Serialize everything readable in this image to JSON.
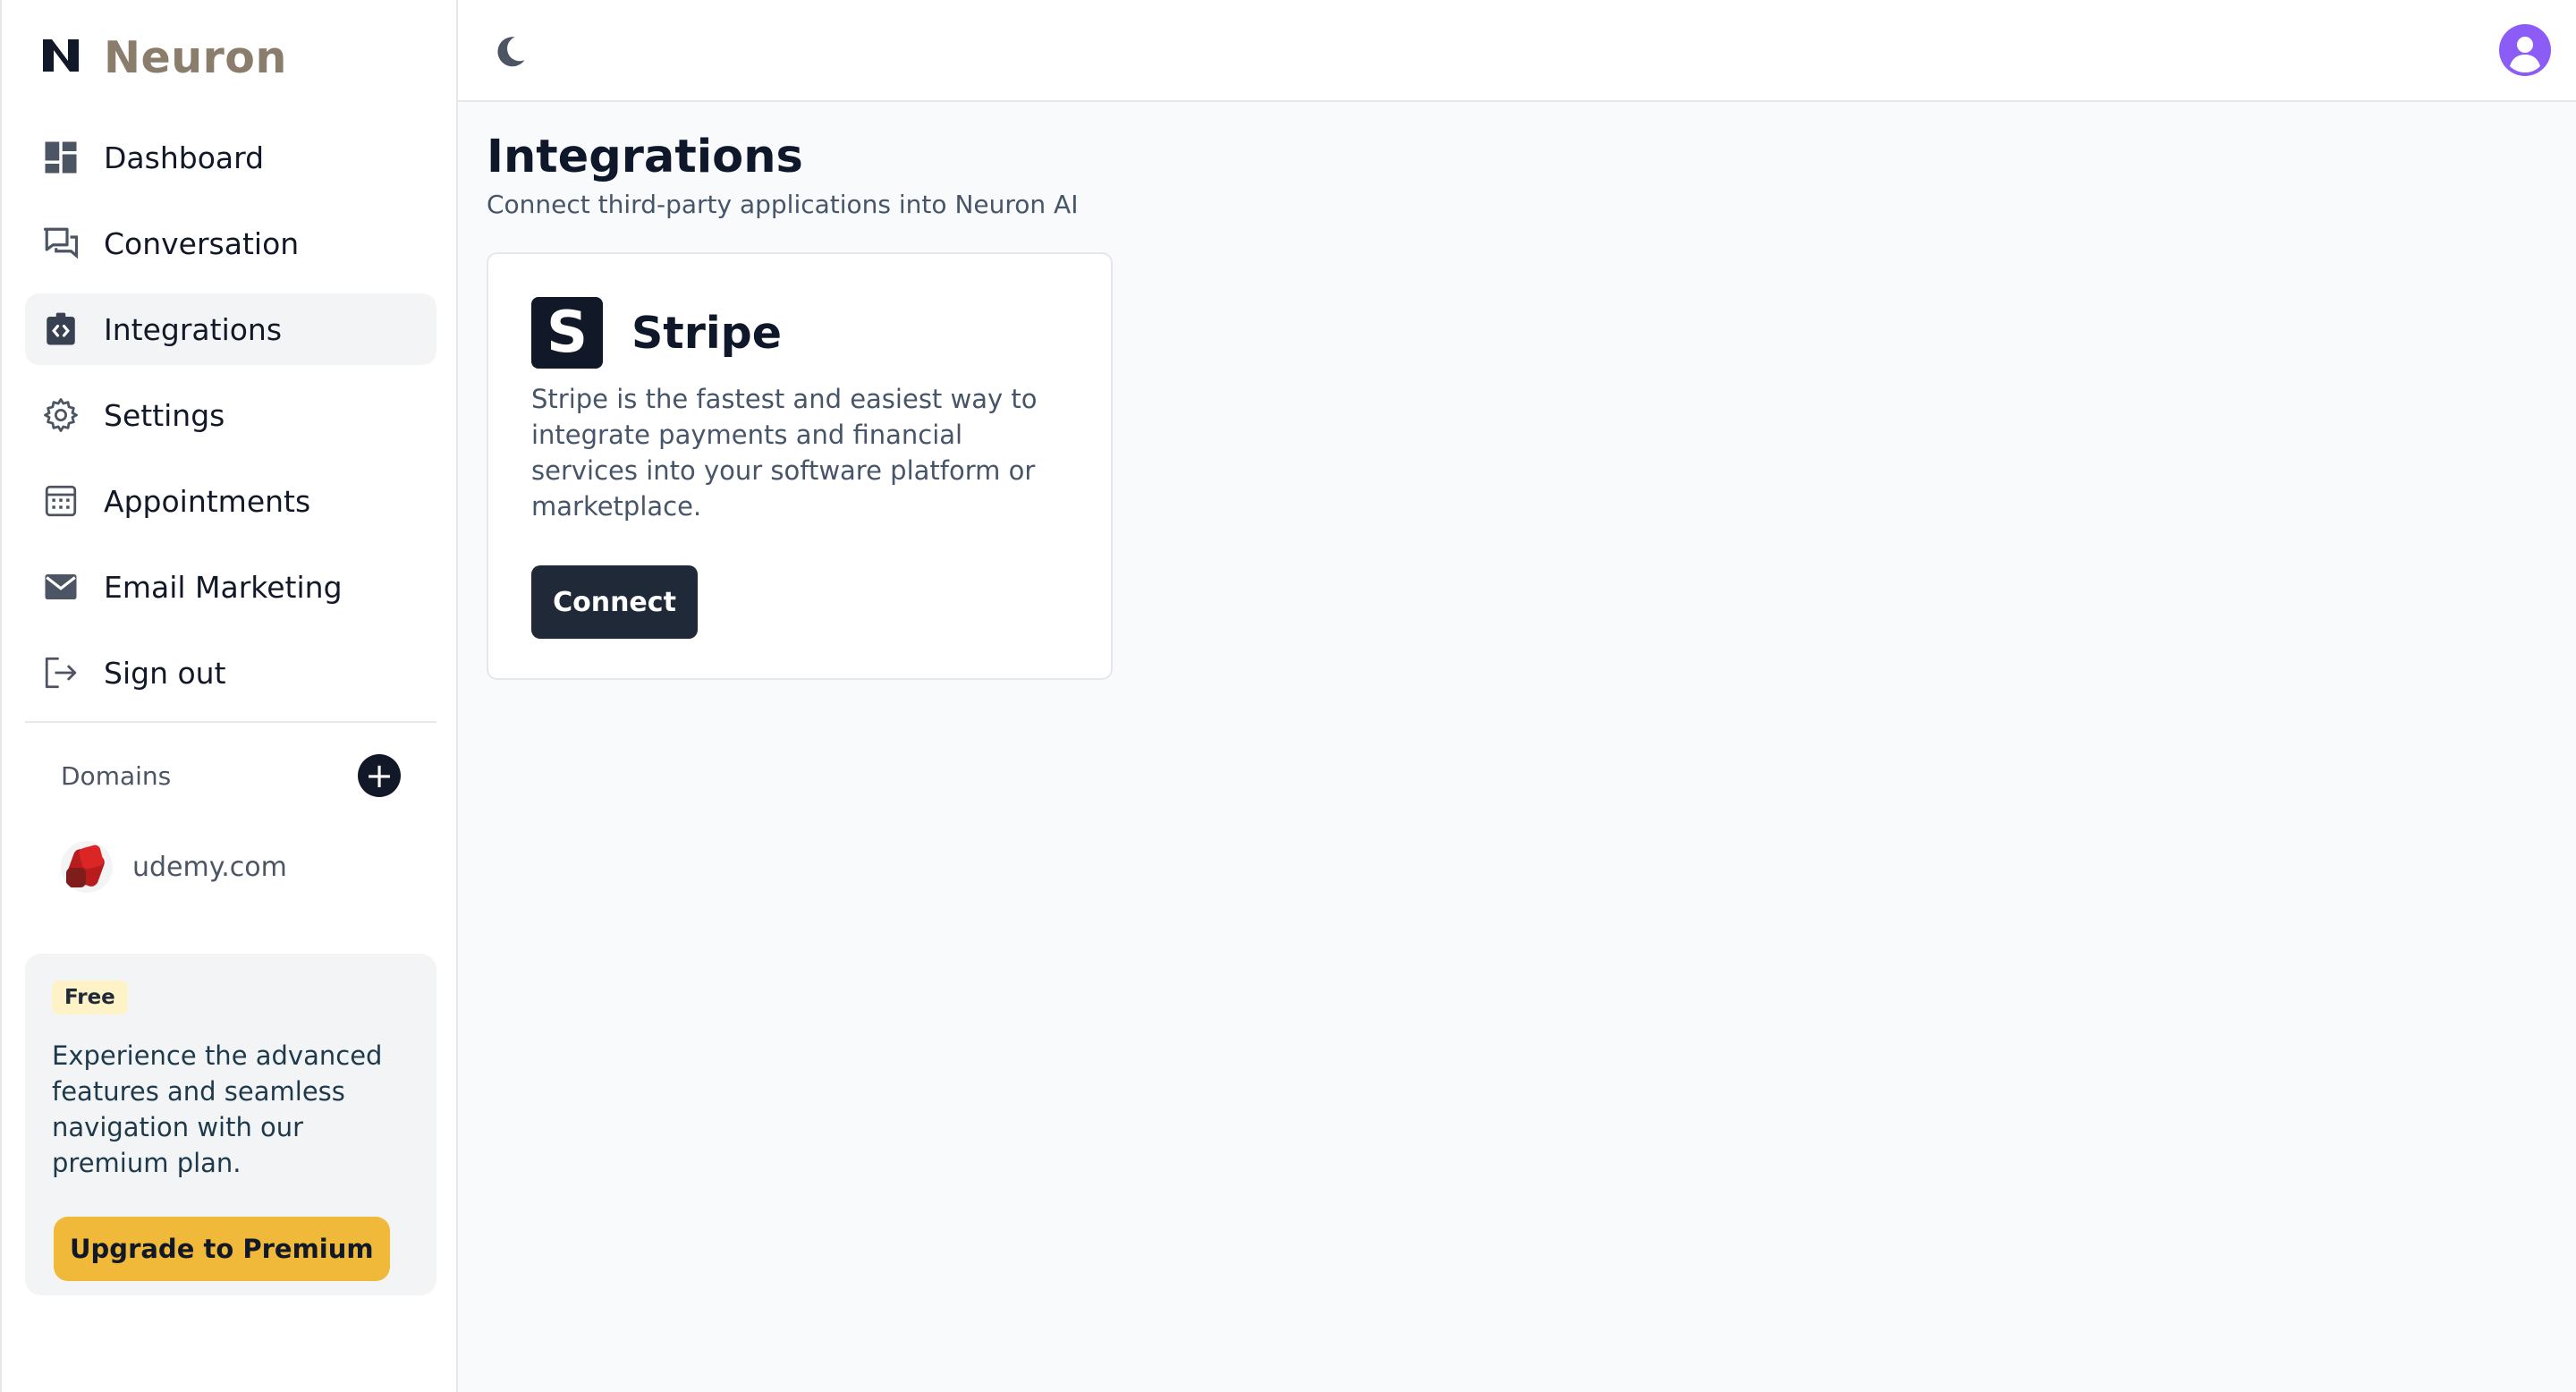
{
  "brand": {
    "name": "Neuron"
  },
  "sidebar": {
    "items": [
      {
        "label": "Dashboard",
        "icon": "dashboard-icon"
      },
      {
        "label": "Conversation",
        "icon": "chat-icon"
      },
      {
        "label": "Integrations",
        "icon": "integrations-icon",
        "active": true
      },
      {
        "label": "Settings",
        "icon": "gear-icon"
      },
      {
        "label": "Appointments",
        "icon": "calendar-icon"
      },
      {
        "label": "Email Marketing",
        "icon": "mail-icon"
      },
      {
        "label": "Sign out",
        "icon": "sign-out-icon"
      }
    ],
    "domains": {
      "title": "Domains",
      "add_icon": "plus-icon",
      "items": [
        {
          "name": "udemy.com"
        }
      ]
    },
    "promo": {
      "badge": "Free",
      "text": "Experience the advanced features and seamless navigation with our premium plan.",
      "button": "Upgrade to Premium"
    }
  },
  "topbar": {
    "theme_icon": "moon-icon",
    "avatar_icon": "user-avatar-icon"
  },
  "page": {
    "title": "Integrations",
    "subtitle": "Connect third-party applications into Neuron AI"
  },
  "integrations": [
    {
      "name": "Stripe",
      "logo_letter": "S",
      "description": "Stripe is the fastest and easiest way to integrate payments and financial services into your software platform or marketplace.",
      "button": "Connect"
    }
  ],
  "colors": {
    "accent": "#f0b93a",
    "dark": "#111827",
    "brand_text": "#8b7d6b",
    "avatar": "#8b5cf6"
  }
}
